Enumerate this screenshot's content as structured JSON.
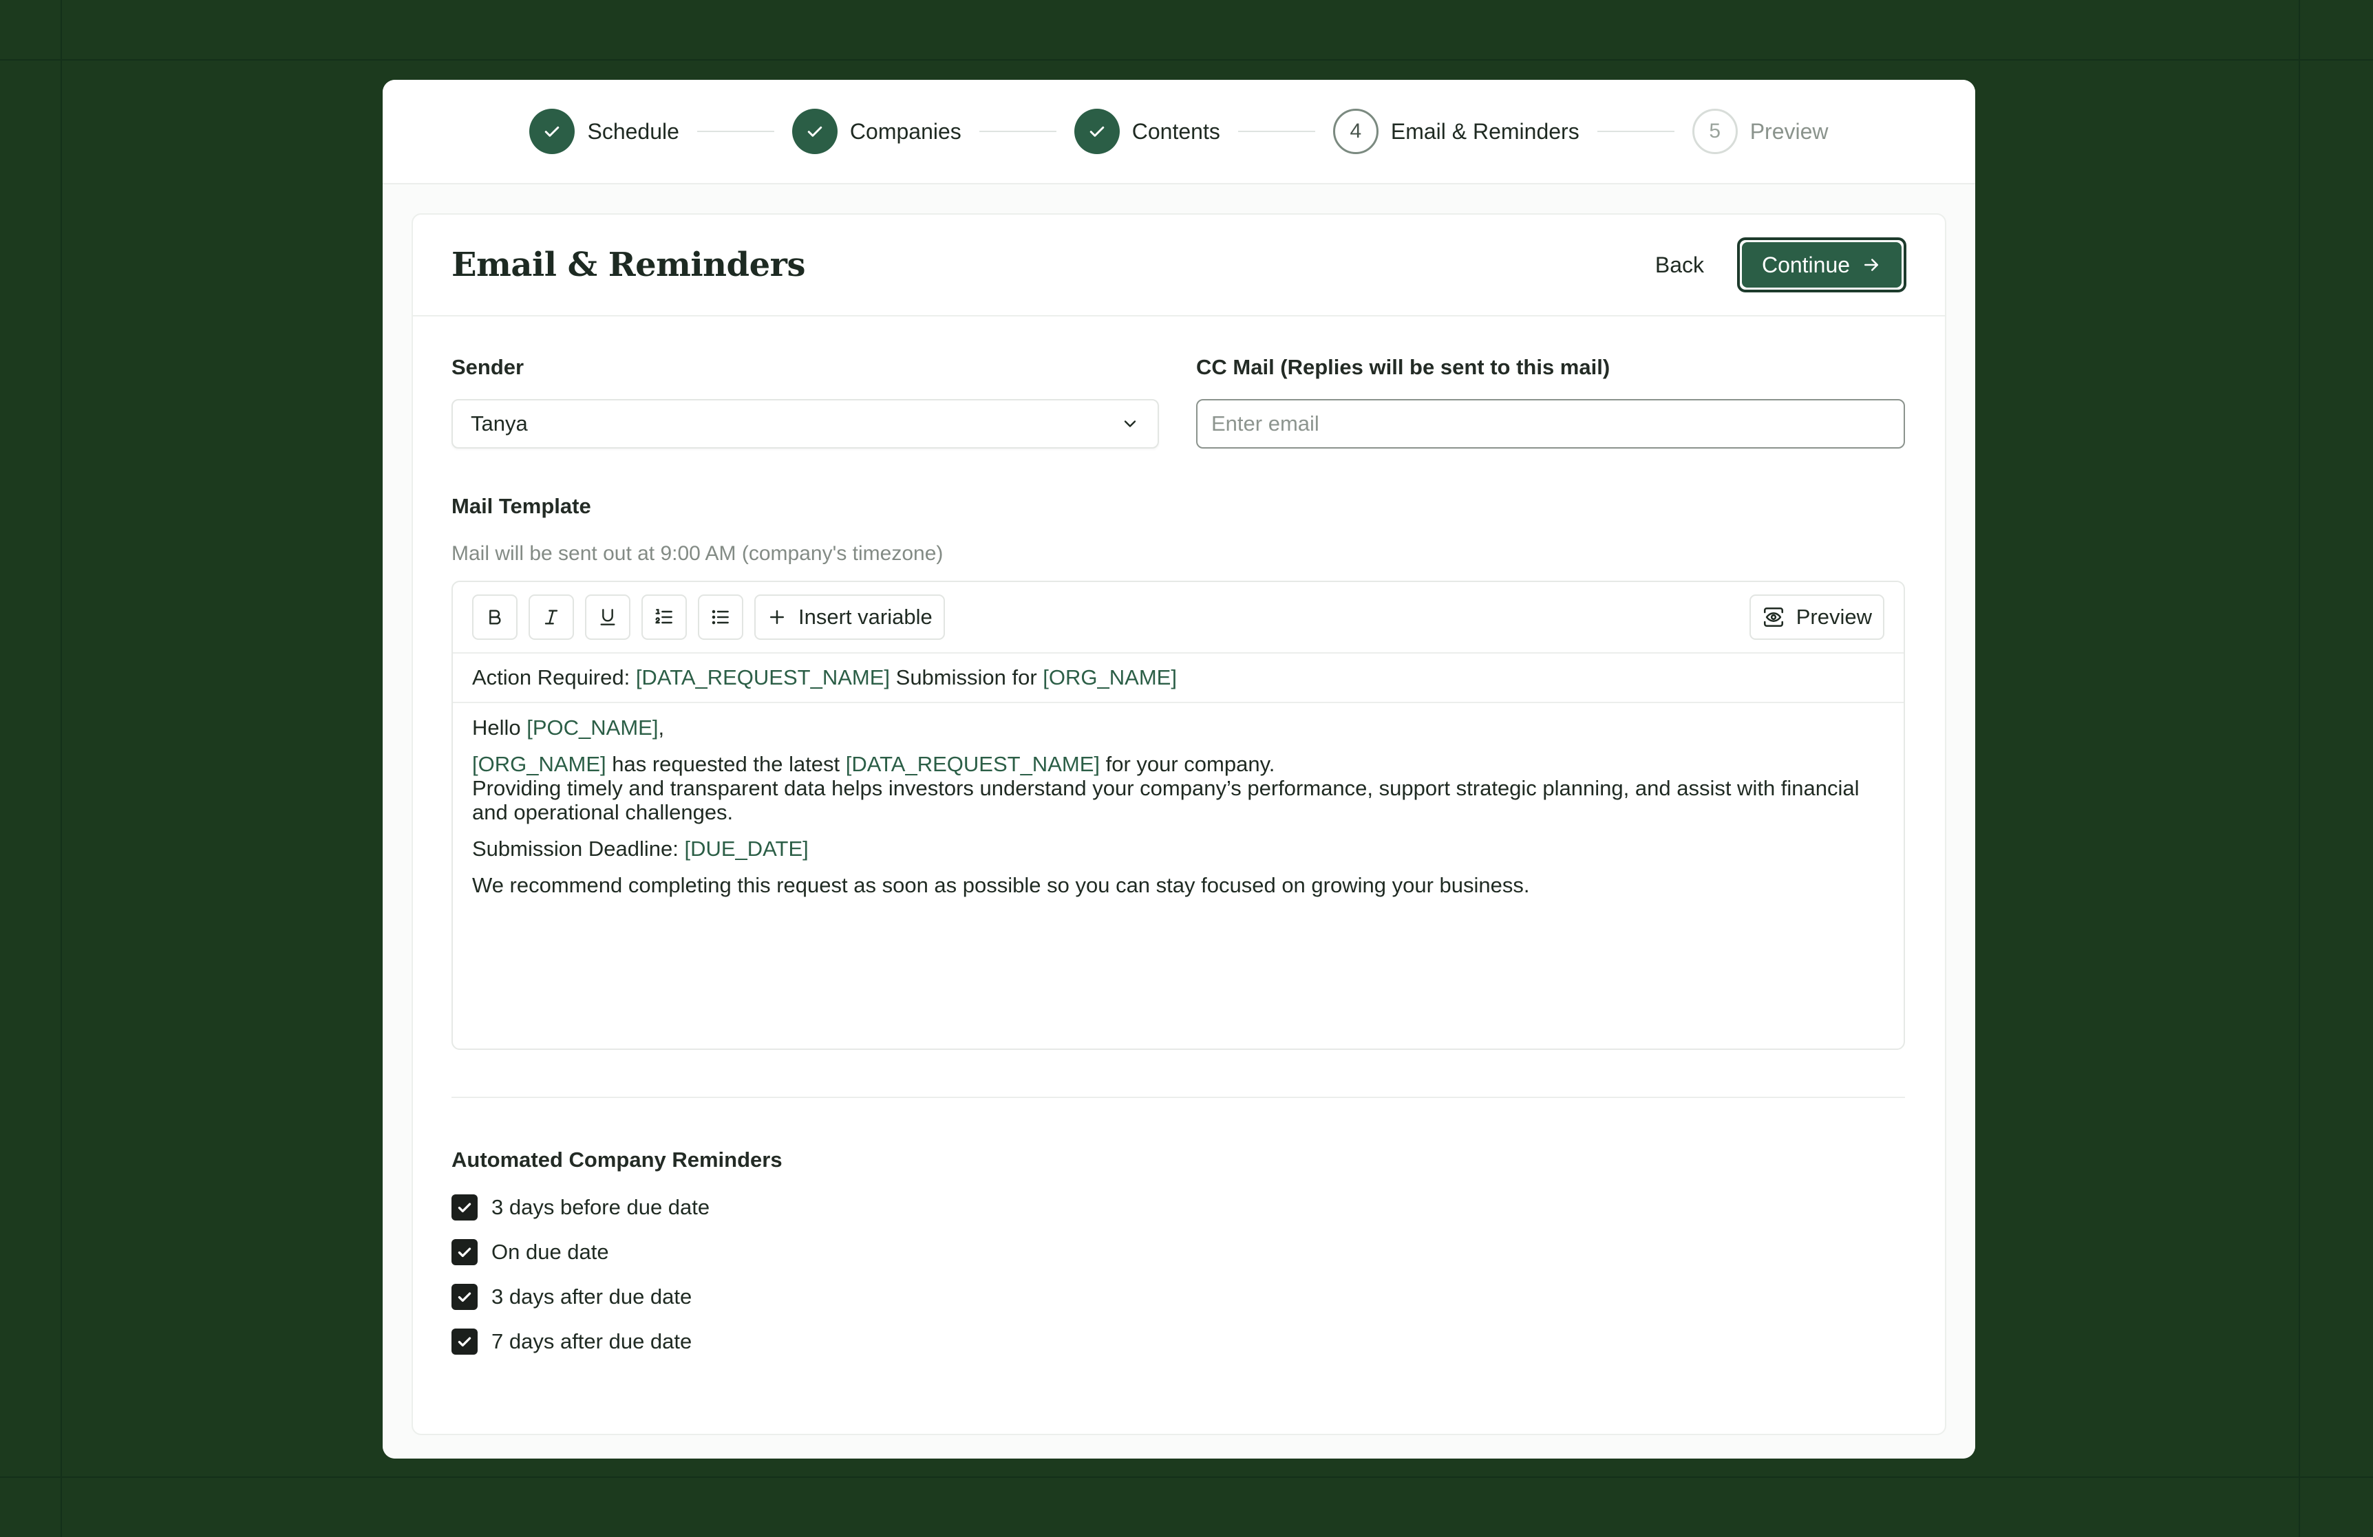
{
  "stepper": {
    "steps": [
      {
        "number": "",
        "label": "Schedule",
        "state": "done"
      },
      {
        "number": "",
        "label": "Companies",
        "state": "done"
      },
      {
        "number": "",
        "label": "Contents",
        "state": "done"
      },
      {
        "number": "4",
        "label": "Email & Reminders",
        "state": "current"
      },
      {
        "number": "5",
        "label": "Preview",
        "state": "todo"
      }
    ]
  },
  "header": {
    "title": "Email & Reminders",
    "back_label": "Back",
    "continue_label": "Continue"
  },
  "sender": {
    "label": "Sender",
    "value": "Tanya"
  },
  "cc": {
    "label": "CC Mail (Replies will be sent to this mail)",
    "placeholder": "Enter email"
  },
  "template": {
    "label": "Mail Template",
    "hint": "Mail will be sent out at 9:00 AM (company's timezone)",
    "toolbar": {
      "insert_label": "Insert variable",
      "preview_label": "Preview"
    },
    "subject": {
      "prefix": "Action Required: ",
      "var1": "[DATA_REQUEST_NAME]",
      "mid": " Submission for ",
      "var2": "[ORG_NAME]"
    },
    "body": {
      "greeting": "Hello ",
      "poc_var": "[POC_NAME]",
      "greeting_end": ",",
      "org_var": "[ORG_NAME]",
      "requested": " has requested the latest ",
      "request_var": "[DATA_REQUEST_NAME]",
      "requested_end": " for your company.",
      "providing": "Providing timely and transparent data helps investors understand your company’s performance, support strategic planning, and assist with financial and operational challenges.",
      "deadline_label": "Submission Deadline: ",
      "due_var": "[DUE_DATE]",
      "recommend": "We recommend completing this request as soon as possible so you can stay focused on growing your business."
    }
  },
  "reminders": {
    "title": "Automated Company Reminders",
    "items": [
      {
        "label": "3 days before due date",
        "checked": true
      },
      {
        "label": "On due date",
        "checked": true
      },
      {
        "label": "3 days after due date",
        "checked": true
      },
      {
        "label": "7 days after due date",
        "checked": true
      }
    ]
  },
  "colors": {
    "background": "#1c3a1e",
    "accent": "#2b5e46",
    "variable": "#2b5e46"
  }
}
